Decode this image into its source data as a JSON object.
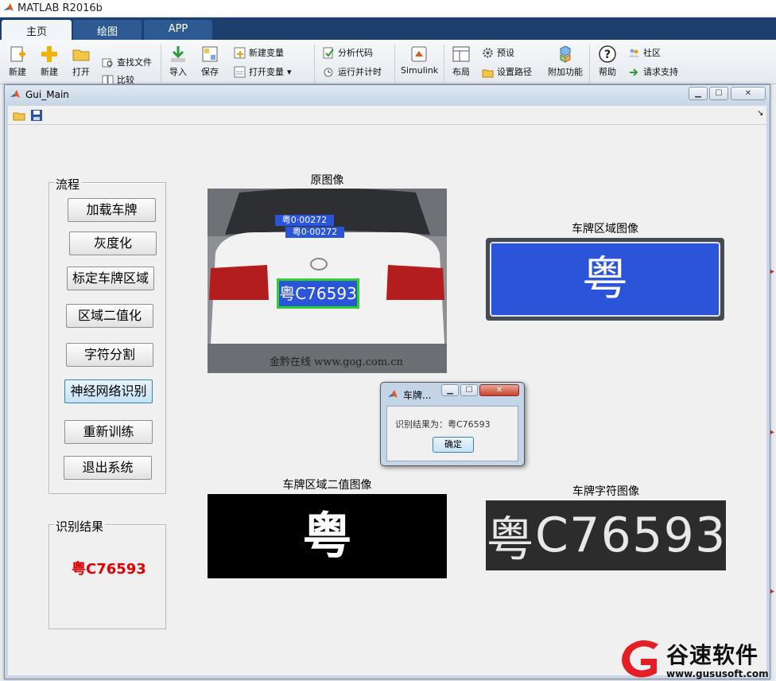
{
  "matlab": {
    "title": "MATLAB R2016b",
    "tabs": [
      {
        "label": "主页",
        "active": true
      },
      {
        "label": "绘图",
        "active": false
      },
      {
        "label": "APP",
        "active": false
      }
    ],
    "ribbon": {
      "new_script": "新建",
      "new": "新建",
      "open": "打开",
      "find_files": "查找文件",
      "compare": "比较",
      "import": "导入",
      "save": "保存",
      "new_variable": "新建变量",
      "open_variable": "打开变量",
      "analyze_code": "分析代码",
      "run_and_time": "运行并计时",
      "simulink": "Simulink",
      "layout": "布局",
      "preferences": "预设",
      "set_path": "设置路径",
      "addons": "附加功能",
      "help": "帮助",
      "community": "社区",
      "request_support": "请求支持"
    }
  },
  "gui": {
    "title": "Gui_Main",
    "flow_panel_title": "流程",
    "buttons": [
      {
        "label": "加载车牌"
      },
      {
        "label": "灰度化"
      },
      {
        "label": "标定车牌区域"
      },
      {
        "label": "区域二值化"
      },
      {
        "label": "字符分割"
      },
      {
        "label": "神经网络识别"
      },
      {
        "label": "重新训练"
      },
      {
        "label": "退出系统"
      }
    ],
    "result_panel_title": "识别结果",
    "result_value": "粤C76593",
    "images": {
      "original_title": "原图像",
      "plate_region_title": "车牌区域图像",
      "binary_title": "车牌区域二值图像",
      "chars_title": "车牌字符图像",
      "plate_text": "粤C·76593",
      "plate_text_small": "粤C76593",
      "windshield_tag": "粤0·00272",
      "photo_watermark": "金黔在线 www.gog.com.cn",
      "chars": [
        "粤",
        "C",
        "7",
        "6",
        "5",
        "9",
        "3"
      ]
    }
  },
  "dialog": {
    "title": "车牌...",
    "message": "识别结果为：粤C76593",
    "ok_label": "确定"
  },
  "watermark": {
    "brand": "谷速软件",
    "url": "www.gususoft.com"
  },
  "colors": {
    "matlab_tabbar": "#1c3f6e",
    "plate_blue": "#2a55d8",
    "result_red": "#e00000",
    "watermark_red": "#e31e24"
  }
}
